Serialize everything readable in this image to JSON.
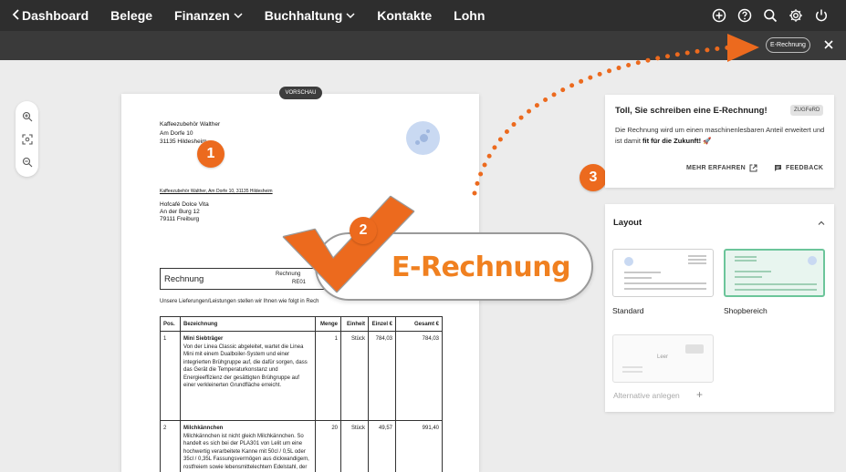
{
  "nav": {
    "items": [
      {
        "label": "Dashboard",
        "dropdown": false
      },
      {
        "label": "Belege",
        "dropdown": false
      },
      {
        "label": "Finanzen",
        "dropdown": true
      },
      {
        "label": "Buchhaltung",
        "dropdown": true
      },
      {
        "label": "Kontakte",
        "dropdown": false
      },
      {
        "label": "Lohn",
        "dropdown": false
      }
    ],
    "right_icons": [
      "plus-circle-icon",
      "help-icon",
      "search-icon",
      "settings-icon",
      "power-icon"
    ]
  },
  "subbar": {
    "badge": "E-Rechnung"
  },
  "document": {
    "preview_label": "VORSCHAU",
    "sender": [
      "Kaffeezubehör Walther",
      "Am Dorfe 10",
      "31135 Hildesheim"
    ],
    "return_line": "Kaffeezubehör Walther, Am Dorfe 10, 31135 Hildesheim",
    "recipient": [
      "Hofcafé Dolce Vita",
      "An der Burg 12",
      "79111 Freiburg"
    ],
    "title": "Rechnung",
    "meta_line1": "Rechnung",
    "meta_line2": "RE01",
    "intro": "Unsere Lieferungen/Leistungen stellen wir Ihnen wie folgt in Rech",
    "table": {
      "headers": [
        "Pos.",
        "Bezeichnung",
        "Menge",
        "Einheit",
        "Einzel €",
        "Gesamt €"
      ],
      "rows": [
        {
          "pos": "1",
          "name": "Mini Siebträger",
          "desc": "Von der Linea Classic abgeleitet, wartet die Linea Mini mit einem Dualboiler-System und einer integrierten Brühgruppe auf, die dafür sorgen, dass das Gerät die Temperaturkonstanz und Energieeffizienz der gesättigten Brühgruppe auf einer verkleinerten Grundfläche erreicht.",
          "menge": "1",
          "einheit": "Stück",
          "einzel": "784,03",
          "gesamt": "784,03"
        },
        {
          "pos": "2",
          "name": "Milchkännchen",
          "desc": "Milchkännchen ist nicht gleich Milchkännchen. So handelt es sich bei der PLA301 von Lelit um eine hochwertig verarbeitete Kanne mit 50cl / 0,5L oder 35cl / 0,35L Fassungsvermögen aus dickwandigem, rostfreiem sowie lebensmittelechtem Edelstahl, der auf der Außenseite auf Hochglanz poliert wurde. Die",
          "menge": "20",
          "einheit": "Stück",
          "einzel": "49,57",
          "gesamt": "991,40"
        }
      ]
    }
  },
  "overlay": {
    "banner_text": "E-Rechnung",
    "badge1": "1",
    "badge2": "2",
    "badge3": "3",
    "accent": "#ec6a1e"
  },
  "info_card": {
    "title": "Toll, Sie schreiben eine E-Rechnung!",
    "tag": "ZUGFeRD",
    "body_plain": "Die Rechnung wird um einen maschinenlesbaren Anteil erweitert und ist damit ",
    "body_bold": "fit für die Zukunft!",
    "body_emoji": "🚀",
    "learn_more": "MEHR ERFAHREN",
    "feedback": "FEEDBACK"
  },
  "layout_card": {
    "title": "Layout",
    "options": [
      {
        "label": "Standard",
        "selected": false
      },
      {
        "label": "Shopbereich",
        "selected": true
      }
    ],
    "empty_label": "Leer",
    "add_alternative": "Alternative anlegen",
    "add_plus": "+"
  }
}
